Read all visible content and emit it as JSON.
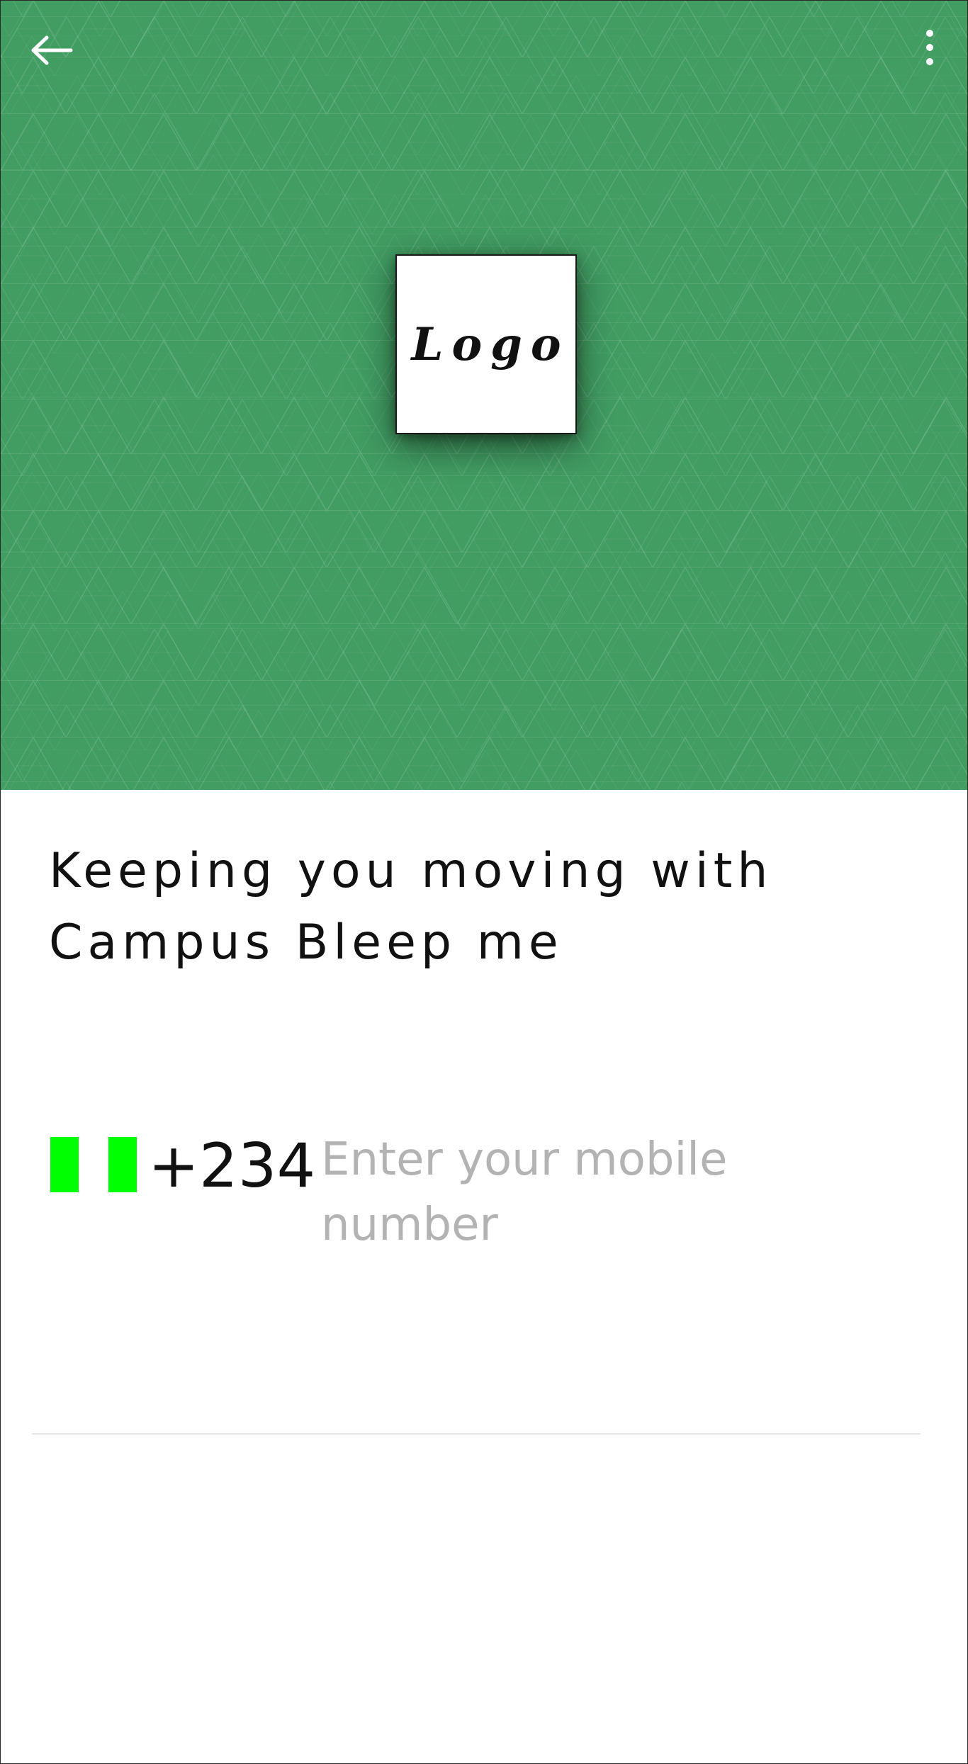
{
  "header": {
    "back_icon": "arrow-left-icon",
    "menu_icon": "more-vertical-icon",
    "background_color": "#419d62"
  },
  "logo": {
    "text": "Logo"
  },
  "headline": {
    "text": "Keeping you moving with Campus Bleep me"
  },
  "phone": {
    "flag_icon": "nigeria-flag-icon",
    "flag_color": "#00ff00",
    "dial_code": "+234",
    "value": "",
    "placeholder": "Enter your mobile number"
  }
}
